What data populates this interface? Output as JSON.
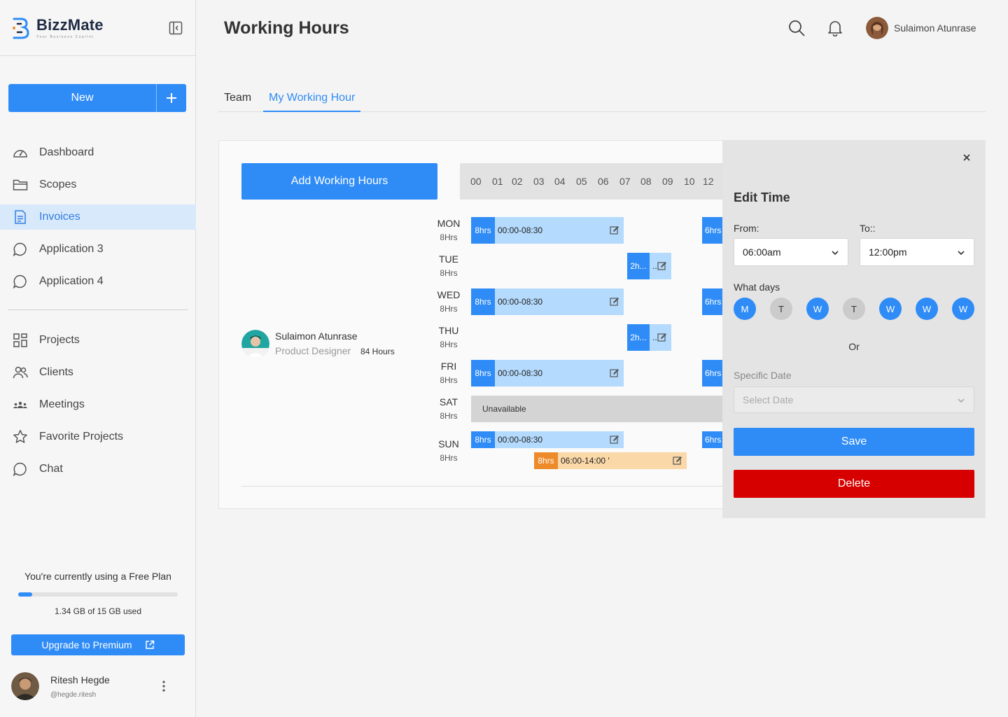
{
  "app": {
    "name": "BizzMate",
    "tagline": "Your Business Copilot"
  },
  "sidebar": {
    "new_label": "New",
    "nav_primary": [
      {
        "label": "Dashboard",
        "icon": "dashboard-icon"
      },
      {
        "label": "Scopes",
        "icon": "folder-icon"
      },
      {
        "label": "Invoices",
        "icon": "invoice-icon",
        "active": true
      },
      {
        "label": "Application 3",
        "icon": "chat-bubble-icon"
      },
      {
        "label": "Application 4",
        "icon": "chat-bubble-icon"
      }
    ],
    "nav_secondary": [
      {
        "label": "Projects",
        "icon": "grid-icon"
      },
      {
        "label": "Clients",
        "icon": "users-icon"
      },
      {
        "label": "Meetings",
        "icon": "group-icon"
      },
      {
        "label": "Favorite Projects",
        "icon": "star-icon"
      },
      {
        "label": "Chat",
        "icon": "chat-bubble-icon"
      }
    ],
    "plan_text": "You're currently using a Free Plan",
    "storage_used_fraction": 0.0893,
    "storage_text": "1.34 GB of 15 GB used",
    "upgrade_label": "Upgrade to Premium",
    "user": {
      "name": "Ritesh Hegde",
      "handle": "@hegde.ritesh"
    }
  },
  "header": {
    "title": "Working Hours",
    "user_name": "Sulaimon Atunrase"
  },
  "tabs": [
    {
      "label": "Team"
    },
    {
      "label": "My Working Hour",
      "active": true
    }
  ],
  "schedule": {
    "add_button": "Add Working Hours",
    "hour_ticks": [
      "00",
      "01",
      "02",
      "03",
      "04",
      "05",
      "06",
      "07",
      "08",
      "09",
      "10",
      "12"
    ],
    "person": {
      "name": "Sulaimon Atunrase",
      "role": "Product Designer",
      "total": "84 Hours"
    },
    "days": [
      {
        "day": "MON",
        "hours": "8Hrs"
      },
      {
        "day": "TUE",
        "hours": "8Hrs"
      },
      {
        "day": "WED",
        "hours": "8Hrs"
      },
      {
        "day": "THU",
        "hours": "8Hrs"
      },
      {
        "day": "FRI",
        "hours": "8Hrs"
      },
      {
        "day": "SAT",
        "hours": "8Hrs"
      },
      {
        "day": "SUN",
        "hours": "8Hrs"
      }
    ],
    "slots": {
      "mon_a": {
        "tag": "8hrs",
        "time": "00:00-08:30"
      },
      "mon_b": {
        "tag": "6hrs"
      },
      "tue_a": {
        "tag": "2h...",
        "time": "..."
      },
      "wed_a": {
        "tag": "8hrs",
        "time": "00:00-08:30"
      },
      "wed_b": {
        "tag": "6hrs"
      },
      "thu_a": {
        "tag": "2h...",
        "time": "..."
      },
      "fri_a": {
        "tag": "8hrs",
        "time": "00:00-08:30"
      },
      "fri_b": {
        "tag": "6hrs"
      },
      "sat_unavailable": "Unavailable",
      "sun_a": {
        "tag": "8hrs",
        "time": "00:00-08:30"
      },
      "sun_b": {
        "tag": "6hrs"
      },
      "sun_c": {
        "tag": "8hrs",
        "time": "06:00-14:00 '"
      }
    }
  },
  "edit_panel": {
    "title": "Edit Time",
    "from_label": "From:",
    "from_value": "06:00am",
    "to_label": "To::",
    "to_value": "12:00pm",
    "days_label": "What days",
    "days": [
      {
        "letter": "M",
        "on": true
      },
      {
        "letter": "T",
        "on": false
      },
      {
        "letter": "W",
        "on": true
      },
      {
        "letter": "T",
        "on": false
      },
      {
        "letter": "W",
        "on": true
      },
      {
        "letter": "W",
        "on": true
      },
      {
        "letter": "W",
        "on": true
      }
    ],
    "or_text": "Or",
    "specific_label": "Specific Date",
    "specific_placeholder": "Select Date",
    "save_label": "Save",
    "delete_label": "Delete"
  },
  "colors": {
    "primary": "#2f8cf7",
    "slot_light": "#b4dafd",
    "orange": "#ed8a2a",
    "danger": "#d70000"
  }
}
